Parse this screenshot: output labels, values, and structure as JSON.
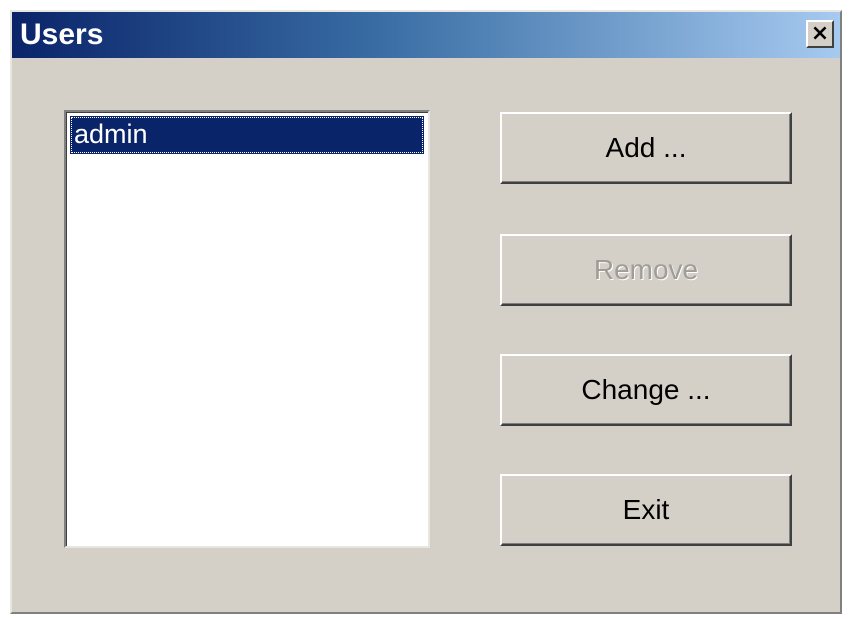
{
  "window": {
    "title": "Users",
    "close_label": "×"
  },
  "users_list": {
    "items": [
      {
        "label": "admin",
        "selected": true
      }
    ]
  },
  "buttons": {
    "add_label": "Add ...",
    "remove_label": "Remove",
    "remove_enabled": false,
    "change_label": "Change ...",
    "exit_label": "Exit"
  },
  "colors": {
    "titlebar_start": "#0a246a",
    "titlebar_end": "#a6caf0",
    "window_bg": "#d4d0c8",
    "selection_bg": "#0a246a",
    "disabled_text": "#a09d96"
  }
}
